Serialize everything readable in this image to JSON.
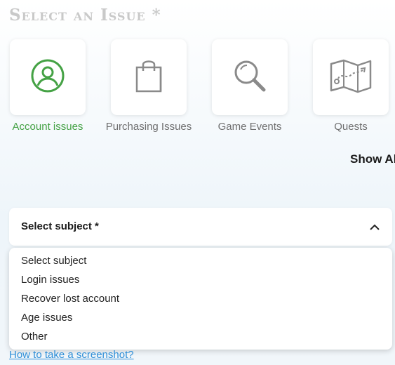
{
  "issue_section": {
    "title": "Select an Issue *",
    "categories": [
      {
        "label": "Account issues",
        "icon": "user-circle-icon",
        "active": true
      },
      {
        "label": "Purchasing Issues",
        "icon": "shopping-bag-icon",
        "active": false
      },
      {
        "label": "Game Events",
        "icon": "magnifier-icon",
        "active": false
      },
      {
        "label": "Quests",
        "icon": "map-icon",
        "active": false
      }
    ],
    "show_all_label": "Show Al"
  },
  "subject": {
    "label": "Select subject *",
    "options": [
      "Select subject",
      "Login issues",
      "Recover lost account",
      "Age issues",
      "Other"
    ]
  },
  "help_link": "How to take a screenshot?",
  "colors": {
    "accent_active": "#45a245",
    "icon_gray": "#8a8a8a",
    "link": "#2f8fd8"
  }
}
